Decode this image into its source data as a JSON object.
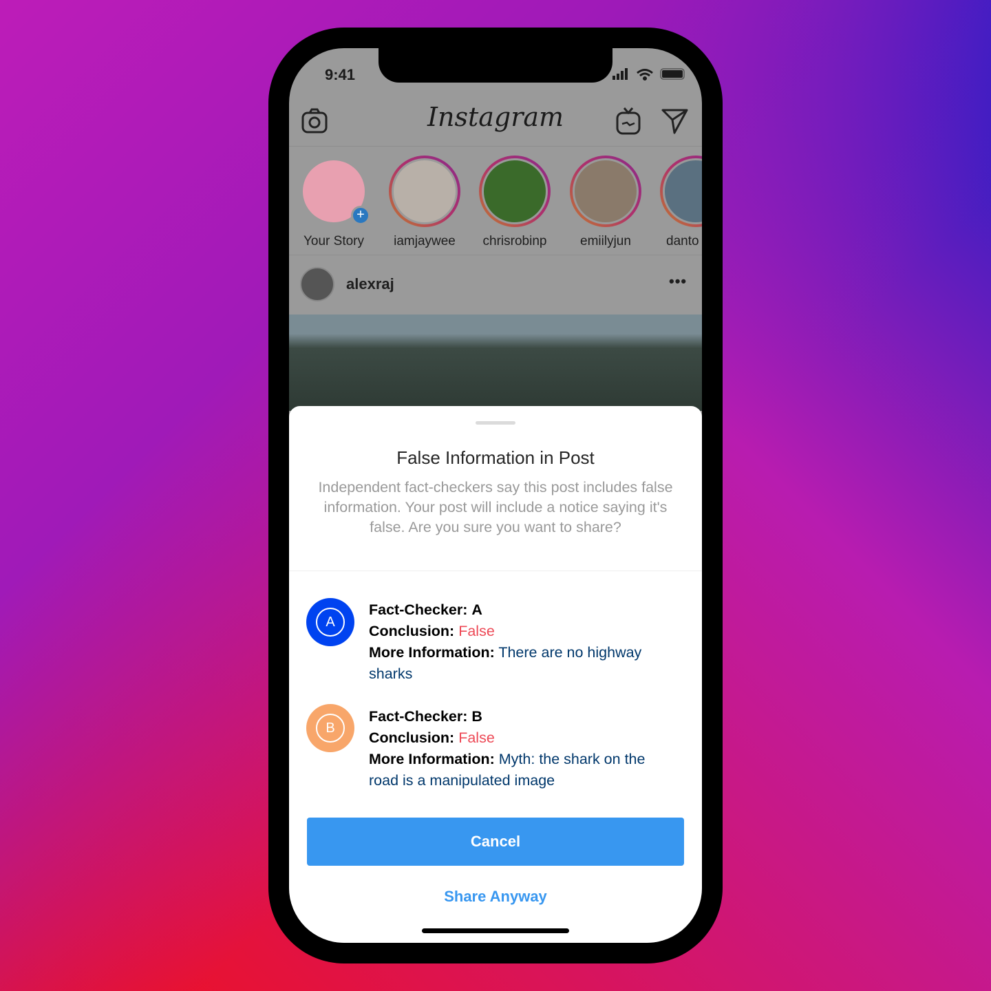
{
  "status_bar": {
    "time": "9:41"
  },
  "header": {
    "logo": "Instagram",
    "icons": [
      "camera-icon",
      "igtv-icon",
      "direct-message-icon"
    ]
  },
  "stories": [
    {
      "label": "Your Story",
      "color": "#e8a0b0",
      "own": true
    },
    {
      "label": "iamjaywee",
      "color": "#b8b0a8"
    },
    {
      "label": "chrisrobinp",
      "color": "#3a6a2a"
    },
    {
      "label": "emiilyjun",
      "color": "#8a7a6a"
    },
    {
      "label": "danto",
      "color": "#5a7080"
    }
  ],
  "post": {
    "username": "alexraj",
    "more_icon": "more-icon"
  },
  "sheet": {
    "title": "False Information in Post",
    "body": "Independent fact-checkers say this post includes false information. Your post will include a notice saying it's false. Are you sure you want to share?",
    "fact_checks": [
      {
        "badge": "A",
        "badge_color": "#0043f0",
        "checker_label": "Fact-Checker:",
        "checker": "A",
        "conclusion_label": "Conclusion:",
        "conclusion": "False",
        "info_label": "More Information:",
        "info": "There are no highway sharks"
      },
      {
        "badge": "B",
        "badge_color": "#f8a66a",
        "checker_label": "Fact-Checker:",
        "checker": "B",
        "conclusion_label": "Conclusion:",
        "conclusion": "False",
        "info_label": "More Information:",
        "info": "Myth: the shark on the road is a manipulated image"
      }
    ],
    "cancel": "Cancel",
    "share_anyway": "Share Anyway"
  },
  "colors": {
    "accent": "#3897f0",
    "false": "#ed4956",
    "info": "#00376b"
  }
}
